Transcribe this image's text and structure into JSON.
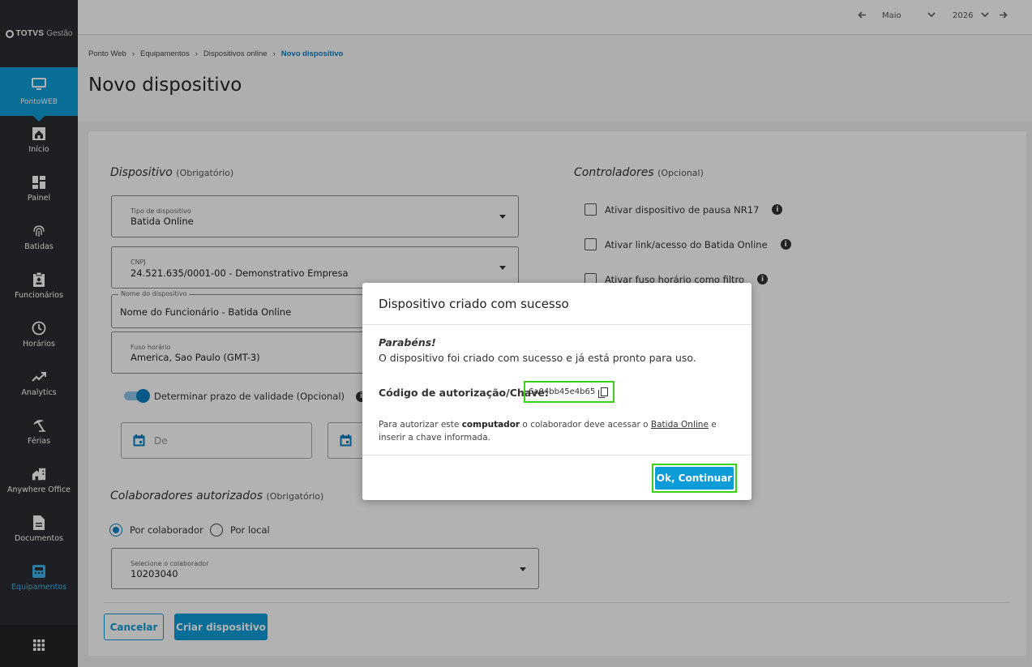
{
  "logo": {
    "brand": "TOTVS",
    "product": "Gestão"
  },
  "sidebar": {
    "active": {
      "label": "PontoWEB",
      "icon": "monitor-icon"
    },
    "items": [
      {
        "label": "Início",
        "icon": "home-icon"
      },
      {
        "label": "Painel",
        "icon": "dashboard-icon"
      },
      {
        "label": "Batidas",
        "icon": "fingerprint-icon"
      },
      {
        "label": "Funcionários",
        "icon": "badge-icon"
      },
      {
        "label": "Horários",
        "icon": "clock-icon"
      },
      {
        "label": "Analytics",
        "icon": "trending-up-icon"
      },
      {
        "label": "Férias",
        "icon": "beach-umbrella-icon"
      },
      {
        "label": "Anywhere Office",
        "icon": "home-work-icon"
      },
      {
        "label": "Documentos",
        "icon": "document-icon"
      },
      {
        "label": "Equipamentos",
        "icon": "device-icon"
      }
    ],
    "bottom_icon": "apps-grid-icon"
  },
  "topbar": {
    "month": "Maio",
    "year": "2026"
  },
  "breadcrumb": [
    "Ponto Web",
    "Equipamentos",
    "Dispositivos online",
    "Novo dispositivo"
  ],
  "breadcrumb_sep": "›",
  "page_title": "Novo dispositivo",
  "form": {
    "device_section": {
      "title": "Dispositivo",
      "hint": "(Obrigatório)"
    },
    "device_type": {
      "label": "Tipo de dispositivo",
      "value": "Batida Online"
    },
    "cnpj": {
      "label": "CNPJ",
      "value": "24.521.635/0001-00 - Demonstrativo Empresa"
    },
    "device_name": {
      "label": "Nome do dispositivo",
      "value": "Nome do Funcionário - Batida Online"
    },
    "timezone": {
      "label": "Fuso horário",
      "value": "America, Sao Paulo (GMT-3)"
    },
    "validity_toggle": {
      "label": "Determinar prazo de validade (Opcional)",
      "on": true
    },
    "date_from": {
      "placeholder": "De"
    },
    "controllers_section": {
      "title": "Controladores",
      "hint": "(Opcional)"
    },
    "controllers": [
      {
        "label": "Ativar dispositivo de pausa NR17",
        "checked": false
      },
      {
        "label": "Ativar link/acesso do Batida Online",
        "checked": false
      },
      {
        "label": "Ativar fuso horário como filtro",
        "checked": false
      }
    ],
    "collab_section": {
      "title": "Colaboradores autorizados",
      "hint": "(Obrigatório)"
    },
    "radio_by_collab": "Por colaborador",
    "radio_by_local": "Por local",
    "collab_select": {
      "label": "Selecione o colaborador",
      "value": "10203040"
    },
    "cancel_label": "Cancelar",
    "create_label": "Criar dispositivo"
  },
  "modal": {
    "title": "Dispositivo criado com sucesso",
    "congrats": "Parabéns!",
    "description": "O dispositivo foi criado com sucesso e já está pronto para uso.",
    "code_label": "Código de autorização/Chave:",
    "code_value": "6a04bb45e4b65",
    "note_p1": "Para autorizar este ",
    "note_b1": "computador",
    "note_p2": " o colaborador deve acessar o ",
    "note_link": "Batida Online",
    "note_p3": " e inserir a chave informada.",
    "ok_label": "Ok, Continuar"
  },
  "colors": {
    "accent": "#0c9cd8",
    "highlight": "#3bd11a",
    "sidebar": "#2b2d31"
  }
}
